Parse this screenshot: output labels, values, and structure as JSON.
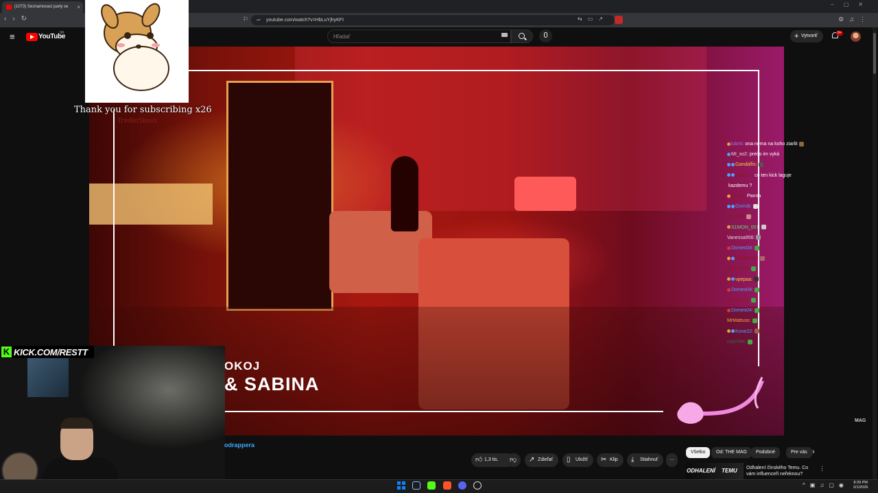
{
  "browser": {
    "tab_title": "(1073) Seznamovací party se",
    "url": "youtube.com/watch?v=HbLuYjhyKFI",
    "close_icon": "close-icon",
    "nav_icons": "‹ › ↻"
  },
  "youtube": {
    "logo_text": "YouTube",
    "country_code": "SK",
    "search_placeholder": "Hľadať",
    "create_label": "Vytvoriť",
    "notification_count": "9+"
  },
  "video": {
    "room_label_line1": "OKOJ",
    "room_label_line2": "& SABINA",
    "watermark": "MAG"
  },
  "overlay": {
    "sub_alert": "Thank you for subscribing x26",
    "sub_name": "frederikoss",
    "kick_url": "KICK.COM/RESTT",
    "kick_letter": "K"
  },
  "chat": [
    {
      "user": "lukmi:",
      "text": "ona nema na koho ziarlit",
      "badges": [
        "b1"
      ],
      "color": "#9b7bff",
      "emote": "#8a6b3a"
    },
    {
      "user": "MI_so2:",
      "text": "prečo im vyká",
      "badges": [
        "b2"
      ],
      "color": "#e0e0e0",
      "emote": ""
    },
    {
      "user": "Gandalfis:",
      "text": "",
      "badges": [
        "b2",
        "b2"
      ],
      "color": "#f2d23b",
      "emote": "#555555"
    },
    {
      "user": "volect...:",
      "text": "co ten kick laguje",
      "badges": [
        "b2",
        "b2"
      ],
      "color": "#8a1a1a",
      "emote": ""
    },
    {
      "user": "",
      "text": "kazdemu ?",
      "badges": [],
      "color": "#ffffff",
      "emote": ""
    },
    {
      "user": "Ferror:",
      "text": "Panna",
      "badges": [
        "b1"
      ],
      "color": "#8a1a1a",
      "emote": ""
    },
    {
      "user": "Gurrub:",
      "text": "",
      "badges": [
        "b2",
        "b2"
      ],
      "color": "#4aa3ff",
      "emote": "#dddddd"
    },
    {
      "user": "Tuzinus:",
      "text": "",
      "badges": [],
      "color": "#8a1a1a",
      "emote": "#c98a8a"
    },
    {
      "user": "S1MON_001:",
      "text": "",
      "badges": [
        "b1"
      ],
      "color": "#59e07b",
      "emote": "#cccccc"
    },
    {
      "user": "Vanessa956:",
      "text": "",
      "badges": [],
      "color": "#e0e0e0",
      "emote": "#999999"
    },
    {
      "user": "Domes04:",
      "text": "",
      "badges": [
        "b3"
      ],
      "color": "#4aa3ff",
      "emote": "#44aa44"
    },
    {
      "user": "Dragemos:",
      "text": "",
      "badges": [
        "b1",
        "b2"
      ],
      "color": "#8a1a1a",
      "emote": "#aa6666"
    },
    {
      "user": "RybaDory:",
      "text": "",
      "badges": [],
      "color": "#8a1a1a",
      "emote": "#44aa44"
    },
    {
      "user": "vpepaa:",
      "text": "",
      "badges": [
        "b1",
        "b2"
      ],
      "color": "#f2d23b",
      "emote": "#333333"
    },
    {
      "user": "Domes04:",
      "text": "",
      "badges": [
        "b3"
      ],
      "color": "#4aa3ff",
      "emote": "#44aa44"
    },
    {
      "user": "RybaDory:",
      "text": "",
      "badges": [],
      "color": "#8a1a1a",
      "emote": "#44aa44"
    },
    {
      "user": "Domes04:",
      "text": "",
      "badges": [
        "b3"
      ],
      "color": "#4aa3ff",
      "emote": "#44aa44"
    },
    {
      "user": "MrMattuss:",
      "text": "",
      "badges": [],
      "color": "#f2a93b",
      "emote": "#44aa44"
    },
    {
      "user": "Knne22:",
      "text": "",
      "badges": [
        "b1",
        "b2"
      ],
      "color": "#4aa3ff",
      "emote": "#a06040"
    },
    {
      "user": "cosiYAK:",
      "text": "",
      "badges": [],
      "color": "#3a6a4a",
      "emote": "#44aa44"
    }
  ],
  "below": {
    "channel_link": "odrappera",
    "actions": {
      "like_count": "1,3 tis.",
      "share": "Zdieľať",
      "save": "Uložiť",
      "clip": "Klip",
      "download": "Stiahnuť",
      "more": "···"
    },
    "chips": [
      "Všetko",
      "Od: THE MAG",
      "Podobné",
      "Pre vás"
    ],
    "rec_thumb_text": "ODHALENÍ",
    "rec_thumb_text2": "TEMU",
    "rec_title": "Odhalení čínského Temu. Co vám influenceři neřeknou?"
  },
  "taskbar": {
    "time": "8:39 PM",
    "date": "2/1/2026"
  },
  "colors": {
    "youtube_red": "#ff0000",
    "kick_green": "#53fc18",
    "link_blue": "#3ea6ff"
  }
}
